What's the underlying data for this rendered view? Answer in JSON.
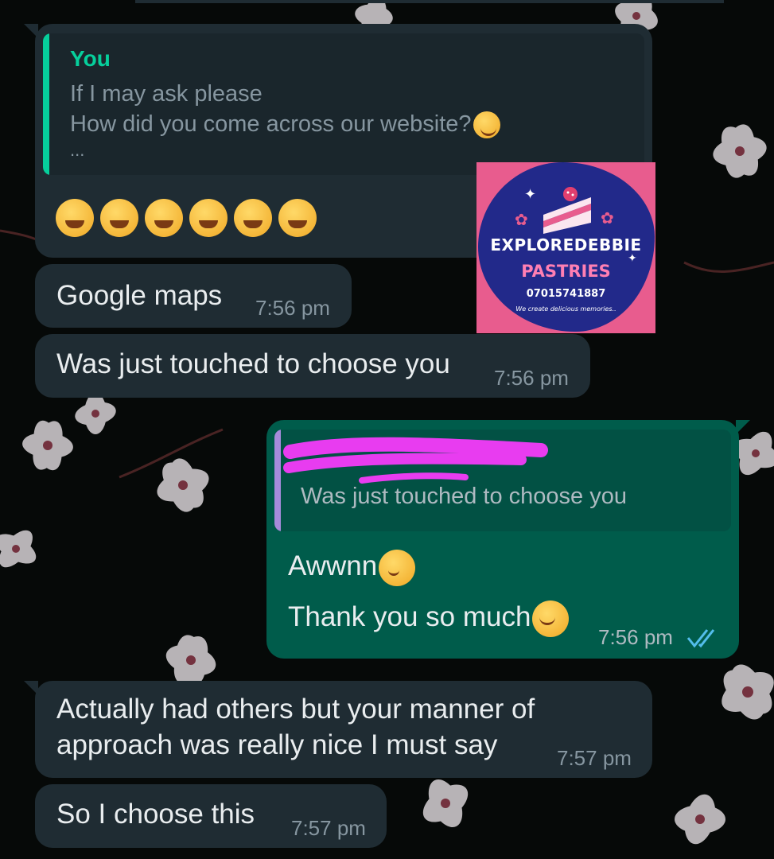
{
  "conversation": {
    "msg1": {
      "quote_name": "You",
      "quote_lines": [
        "If I may ask please",
        "How did you come across our website?",
        "..."
      ],
      "emoji_name": "rolling-on-floor-laughing-icon",
      "emoji_count": 6
    },
    "msg2": {
      "text": "Google maps",
      "time": "7:56 pm"
    },
    "msg3": {
      "text": "Was just touched to choose you",
      "time": "7:56 pm"
    },
    "msg4": {
      "quote_text": "Was just touched to choose you",
      "line1": "Awwnn",
      "line2": "Thank you so much",
      "time": "7:56 pm",
      "status_icon": "double-check-read-icon"
    },
    "msg5": {
      "lines": [
        "Actually had others but your manner of",
        "approach was really nice I must say"
      ],
      "time": "7:57 pm"
    },
    "msg6": {
      "text": "So I choose this",
      "time": "7:57 pm"
    }
  },
  "watermark": {
    "brand": "EXPLOREDEBBIE",
    "sub": "PASTRIES",
    "phone": "07015741887",
    "tagline": "We create delicious memories.."
  },
  "colors": {
    "incoming_bubble": "#1f2c33",
    "outgoing_bubble": "#005c4b",
    "quote_you": "#06cf9c",
    "quote_other": "#a78bdb",
    "read_ticks": "#53bdeb",
    "redaction": "#e83cf0"
  }
}
